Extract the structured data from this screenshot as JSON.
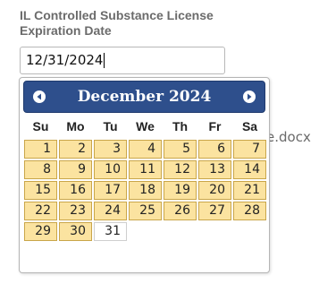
{
  "field": {
    "label": "IL Controlled Substance License Expiration Date",
    "value": "12/31/2024"
  },
  "background": {
    "filename_fragment": "e.docx"
  },
  "datepicker": {
    "month_year": "December 2024",
    "prev_icon": "circle-triangle-left-icon",
    "next_icon": "circle-triangle-right-icon",
    "weekdays": [
      "Su",
      "Mo",
      "Tu",
      "We",
      "Th",
      "Fr",
      "Sa"
    ],
    "weeks": [
      [
        "1",
        "2",
        "3",
        "4",
        "5",
        "6",
        "7"
      ],
      [
        "8",
        "9",
        "10",
        "11",
        "12",
        "13",
        "14"
      ],
      [
        "15",
        "16",
        "17",
        "18",
        "19",
        "20",
        "21"
      ],
      [
        "22",
        "23",
        "24",
        "25",
        "26",
        "27",
        "28"
      ],
      [
        "29",
        "30",
        "31"
      ]
    ],
    "selected_day": "31",
    "colors": {
      "header_bg": "#2e4f8c",
      "day_bg": "#fbe3a0",
      "day_border": "#c9a64a",
      "selected_bg": "#ffffff"
    }
  }
}
